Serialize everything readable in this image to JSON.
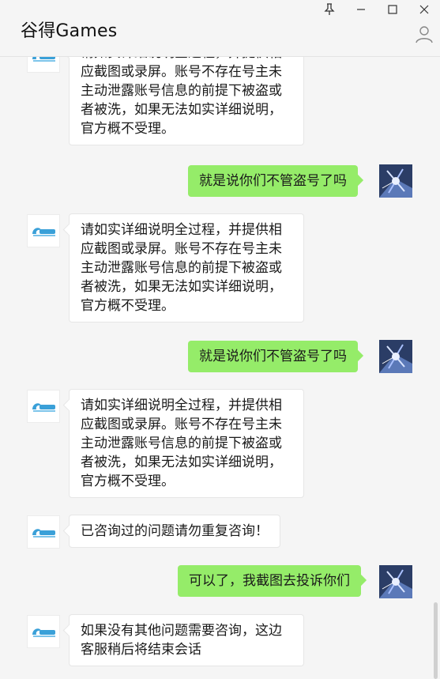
{
  "window": {
    "title": "谷得Games"
  },
  "messages": [
    {
      "side": "left",
      "text": "请如实详细说明全过程，并提供相应截图或录屏。账号不存在号主未主动泄露账号信息的前提下被盗或者被洗，如果无法如实详细说明，官方概不受理。"
    },
    {
      "side": "right",
      "text": "就是说你们不管盗号了吗"
    },
    {
      "side": "left",
      "text": "请如实详细说明全过程，并提供相应截图或录屏。账号不存在号主未主动泄露账号信息的前提下被盗或者被洗，如果无法如实详细说明，官方概不受理。"
    },
    {
      "side": "right",
      "text": "就是说你们不管盗号了吗"
    },
    {
      "side": "left",
      "text": "请如实详细说明全过程，并提供相应截图或录屏。账号不存在号主未主动泄露账号信息的前提下被盗或者被洗，如果无法如实详细说明，官方概不受理。"
    },
    {
      "side": "left",
      "text": "已咨询过的问题请勿重复咨询！"
    },
    {
      "side": "right",
      "text": "可以了，我截图去投诉你们"
    },
    {
      "side": "left",
      "text": "如果没有其他问题需要咨询，这边客服稍后将结束会话"
    }
  ],
  "colors": {
    "self_bubble": "#95ec69",
    "other_bubble": "#ffffff",
    "background": "#f5f5f5",
    "brand_logo": "#3aa0d8"
  },
  "icons": {
    "pin": "pin-icon",
    "minimize": "minimize-icon",
    "maximize": "maximize-icon",
    "close": "close-icon",
    "profile": "profile-icon"
  }
}
